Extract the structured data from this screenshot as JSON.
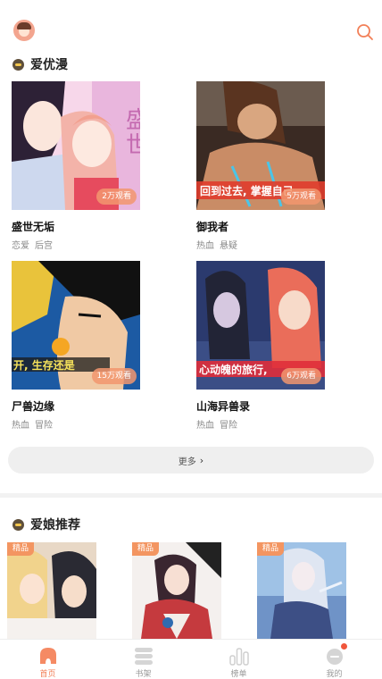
{
  "header": {
    "avatar_icon": "user-avatar",
    "search_icon": "search-icon",
    "accent": "#f27f57"
  },
  "section_love": {
    "title": "爱优漫",
    "items": [
      {
        "title": "盛世无垢",
        "views": "2万观看",
        "tags": [
          "恋爱",
          "后宫"
        ]
      },
      {
        "title": "御我者",
        "views": "5万观看",
        "tags": [
          "热血",
          "悬疑"
        ]
      },
      {
        "title": "尸兽边缘",
        "views": "15万观看",
        "tags": [
          "热血",
          "冒险"
        ]
      },
      {
        "title": "山海异兽录",
        "views": "6万观看",
        "tags": [
          "热血",
          "冒险"
        ]
      }
    ],
    "more_label": "更多"
  },
  "section_recommend": {
    "title": "爱娘推荐",
    "items": [
      {
        "badge": "精品"
      },
      {
        "badge": "精品"
      },
      {
        "badge": "精品"
      }
    ]
  },
  "tabbar": {
    "tabs": [
      {
        "label": "首页",
        "icon": "home-icon",
        "active": true
      },
      {
        "label": "书架",
        "icon": "bookshelf-icon",
        "active": false
      },
      {
        "label": "榜单",
        "icon": "ranking-icon",
        "active": false
      },
      {
        "label": "我的",
        "icon": "profile-icon",
        "active": false
      }
    ]
  }
}
